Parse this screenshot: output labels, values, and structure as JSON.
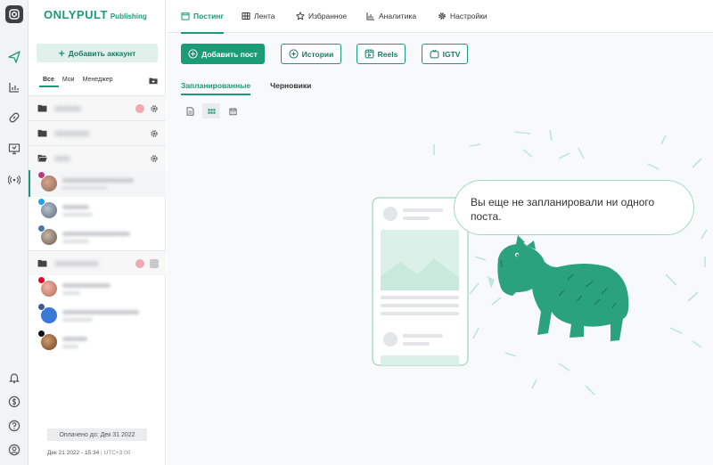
{
  "brand": {
    "name": "ONLYPULT",
    "suffix": "Publishing"
  },
  "rail_icons": [
    "camera-icon",
    "send-icon",
    "analytics-icon",
    "link-icon",
    "monitor-icon",
    "broadcast-icon",
    "bell-icon",
    "dollar-icon",
    "help-icon",
    "user-icon"
  ],
  "sidebar": {
    "add_account": "Добавить аккаунт",
    "filter_tabs": [
      "Все",
      "Мои",
      "Менеджер"
    ],
    "paid_until": "Оплачено до: Дек 31 2022",
    "datetime": "Дек 21 2022 - 15:34",
    "timezone": "UTC+3:00"
  },
  "topnav": {
    "posting": "Постинг",
    "feed": "Лента",
    "favorites": "Избранное",
    "analytics": "Аналитика",
    "settings": "Настройки"
  },
  "toolbar": {
    "add_post": "Добавить пост",
    "stories": "Истории",
    "reels": "Reels",
    "igtv": "IGTV"
  },
  "subtabs": {
    "scheduled": "Запланированные",
    "drafts": "Черновики"
  },
  "empty_message": "Вы еще не запланировали ни одного поста.",
  "colors": {
    "accent": "#1b9b76",
    "accent_light": "#dff1ea",
    "capybara": "#2aa27d"
  }
}
